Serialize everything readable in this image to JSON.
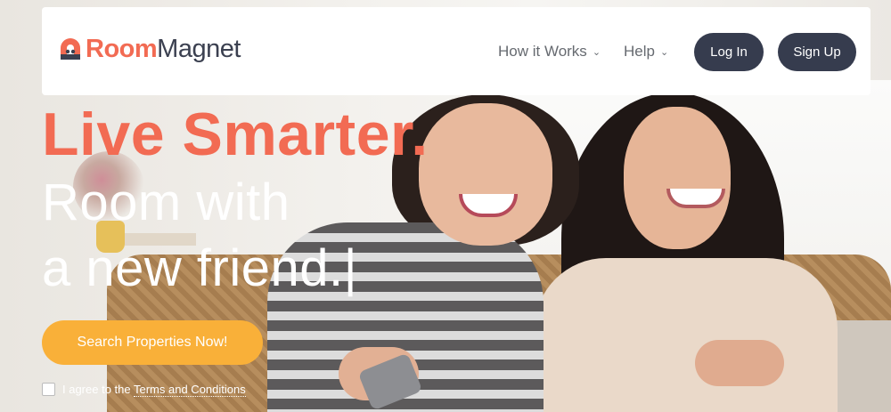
{
  "brand": {
    "name_part1": "Room",
    "name_part2": "Magnet",
    "colors": {
      "coral": "#f26b53",
      "navy": "#363c4e",
      "orange": "#f9b039"
    }
  },
  "nav": {
    "how_it_works": "How it Works",
    "help": "Help",
    "login": "Log In",
    "signup": "Sign Up"
  },
  "hero": {
    "headline": "Live Smarter.",
    "line1": "Room with",
    "line2": "a new friend.",
    "cursor": "|",
    "cta": "Search Properties Now!",
    "agree_prefix": "I agree to the ",
    "agree_link": "Terms and Conditions"
  },
  "icons": [
    "logo-magnet-icon",
    "chevron-down-icon",
    "checkbox-icon"
  ]
}
